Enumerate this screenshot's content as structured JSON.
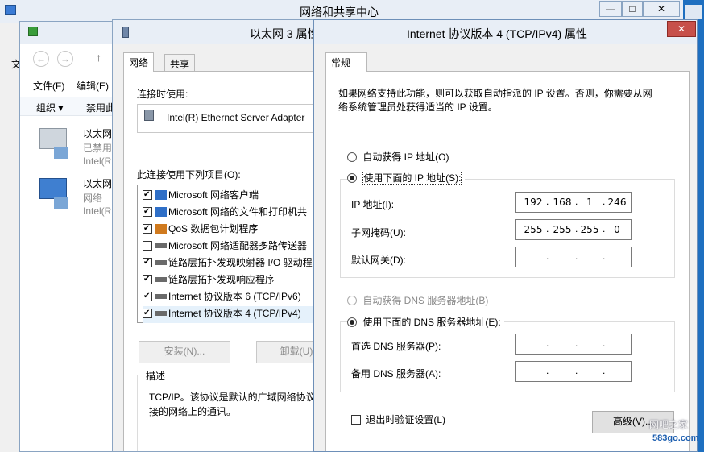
{
  "nsc_window": {
    "title": "网络和共享中心",
    "buttons": {
      "minimize": "—",
      "maximize": "□",
      "close": "✕"
    },
    "left_label": "文"
  },
  "connections_window": {
    "menu": [
      "文件(F)",
      "编辑(E)"
    ],
    "toolbar": [
      "组织 ▾",
      "禁用此"
    ],
    "adapters": [
      {
        "name": "以太网",
        "status": "已禁用",
        "device": "Intel(R"
      },
      {
        "name": "以太网",
        "status": "网络",
        "device": "Intel(R"
      }
    ]
  },
  "eth_props": {
    "title": "以太网 3 属性",
    "tabs": [
      "网络",
      "共享"
    ],
    "connect_using_label": "连接时使用:",
    "adapter_name": "Intel(R) Ethernet Server Adapter",
    "items_label": "此连接使用下列项目(O):",
    "items": [
      {
        "checked": true,
        "label": "Microsoft 网络客户端"
      },
      {
        "checked": true,
        "label": "Microsoft 网络的文件和打印机共"
      },
      {
        "checked": true,
        "label": "QoS 数据包计划程序"
      },
      {
        "checked": false,
        "label": "Microsoft 网络适配器多路传送器"
      },
      {
        "checked": true,
        "label": "链路层拓扑发现映射器 I/O 驱动程"
      },
      {
        "checked": true,
        "label": "链路层拓扑发现响应程序"
      },
      {
        "checked": true,
        "label": "Internet 协议版本 6 (TCP/IPv6)"
      },
      {
        "checked": true,
        "label": "Internet 协议版本 4 (TCP/IPv4)"
      }
    ],
    "install_button": "安装(N)...",
    "uninstall_button": "卸载(U)",
    "description_title": "描述",
    "description_line1": "TCP/IP。该协议是默认的广域网络协议",
    "description_line2": "接的网络上的通讯。"
  },
  "ipv4_dialog": {
    "title": "Internet 协议版本 4 (TCP/IPv4) 属性",
    "close": "✕",
    "tab": "常规",
    "intro_line1": "如果网络支持此功能，则可以获取自动指派的 IP 设置。否则，你需要从网",
    "intro_line2": "络系统管理员处获得适当的 IP 设置。",
    "auto_ip": "自动获得 IP 地址(O)",
    "manual_ip": "使用下面的 IP 地址(S):",
    "ip_label": "IP 地址(I):",
    "ip_address": [
      "192",
      "168",
      "1",
      "246"
    ],
    "mask_label": "子网掩码(U):",
    "subnet_mask": [
      "255",
      "255",
      "255",
      "0"
    ],
    "gateway_label": "默认网关(D):",
    "auto_dns": "自动获得 DNS 服务器地址(B)",
    "manual_dns": "使用下面的 DNS 服务器地址(E):",
    "dns1_label": "首选 DNS 服务器(P):",
    "dns2_label": "备用 DNS 服务器(A):",
    "validate_label": "退出时验证设置(L)",
    "advanced_button": "高级(V)...",
    "selected_ip_mode": "manual",
    "selected_dns_mode": "manual",
    "validate_checked": false
  },
  "watermark": {
    "brand": "网吧之家",
    "url": "583go.com"
  }
}
